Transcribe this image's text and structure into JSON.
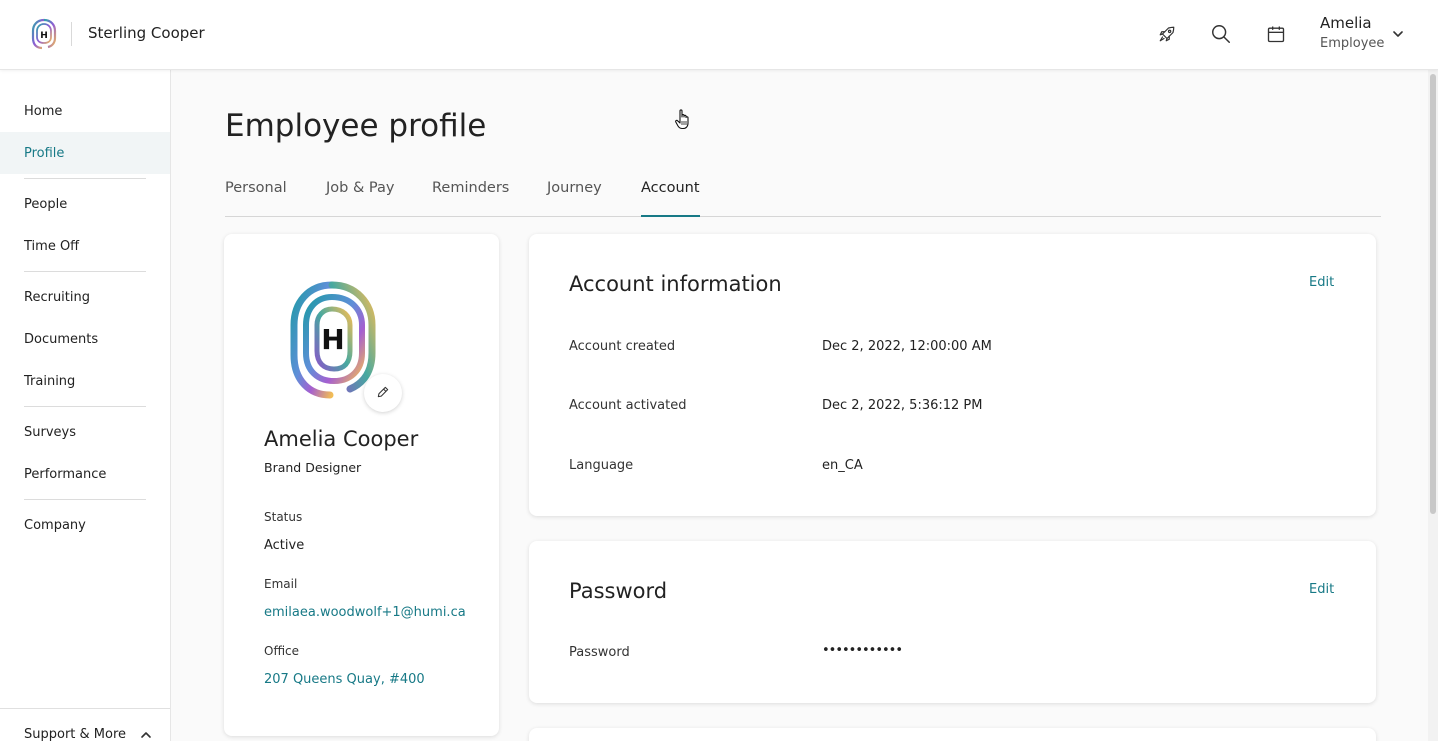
{
  "header": {
    "company": "Sterling Cooper",
    "user_name": "Amelia",
    "user_role": "Employee"
  },
  "icons": {
    "logo": "humi-fingerprint-logo",
    "rocket": "rocket-icon",
    "search": "search-icon",
    "calendar": "calendar-icon",
    "chevron": "chevron-down-icon"
  },
  "sidebar": {
    "items": [
      {
        "label": "Home"
      },
      {
        "label": "Profile",
        "active": true
      },
      {
        "label": "People"
      },
      {
        "label": "Time Off"
      },
      {
        "label": "Recruiting"
      },
      {
        "label": "Documents"
      },
      {
        "label": "Training"
      },
      {
        "label": "Surveys"
      },
      {
        "label": "Performance"
      },
      {
        "label": "Company"
      }
    ],
    "support_label": "Support & More"
  },
  "main": {
    "title": "Employee profile",
    "tabs": [
      {
        "label": "Personal"
      },
      {
        "label": "Job & Pay"
      },
      {
        "label": "Reminders"
      },
      {
        "label": "Journey"
      },
      {
        "label": "Account",
        "active": true
      }
    ]
  },
  "profile": {
    "name": "Amelia Cooper",
    "job_title": "Brand Designer",
    "status_label": "Status",
    "status_value": "Active",
    "email_label": "Email",
    "email_value": "emilaea.woodwolf+1@humi.ca",
    "office_label": "Office",
    "office_value": "207 Queens Quay, #400"
  },
  "account": {
    "title": "Account information",
    "edit_label": "Edit",
    "rows": [
      {
        "label": "Account created",
        "value": "Dec 2, 2022, 12:00:00 AM"
      },
      {
        "label": "Account activated",
        "value": "Dec 2, 2022, 5:36:12 PM"
      },
      {
        "label": "Language",
        "value": "en_CA"
      }
    ]
  },
  "password": {
    "title": "Password",
    "edit_label": "Edit",
    "label": "Password",
    "value": "••••••••••••"
  },
  "colors": {
    "accent": "#177986",
    "active_nav_bg": "#f1f5f6"
  }
}
